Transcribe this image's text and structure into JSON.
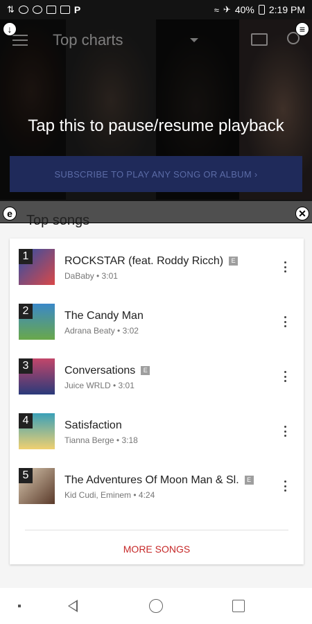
{
  "status_bar": {
    "icons_left": [
      "arrows-icon",
      "bluetooth-icon",
      "data-saver-icon",
      "messages-icon",
      "download-icon"
    ],
    "left_glyph": "P",
    "battery": "40%",
    "time": "2:19 PM"
  },
  "appbar": {
    "title": "Top charts"
  },
  "overlay": {
    "hint": "Tap this to pause/resume playback",
    "bubble_top_left": "↓",
    "bubble_top_right": "≡",
    "bubble_mid_left": "e",
    "bubble_mid_right": "✕"
  },
  "subscribe_label": "SUBSCRIBE TO PLAY ANY SONG OR ALBUM ›",
  "section_title": "Top songs",
  "songs": [
    {
      "rank": "1",
      "title": "ROCKSTAR (feat. Roddy Ricch)",
      "meta": "DaBaby • 3:01",
      "explicit": "E",
      "colors": [
        "#2b4fa8",
        "#d94848"
      ]
    },
    {
      "rank": "2",
      "title": "The Candy Man",
      "meta": "Adrana Beaty • 3:02",
      "explicit": "",
      "colors": [
        "#3a88c8",
        "#6aa84a"
      ]
    },
    {
      "rank": "3",
      "title": "Conversations",
      "meta": "Juice WRLD • 3:01",
      "explicit": "E",
      "colors": [
        "#c2466a",
        "#2a3a7a"
      ]
    },
    {
      "rank": "4",
      "title": "Satisfaction",
      "meta": "Tianna Berge • 3:18",
      "explicit": "",
      "colors": [
        "#3aa0b8",
        "#f0d070"
      ]
    },
    {
      "rank": "5",
      "title": "The Adventures Of Moon Man & Sl.",
      "meta": "Kid Cudi, Eminem • 4:24",
      "explicit": "E",
      "colors": [
        "#d8c8b0",
        "#5a3a2a"
      ]
    }
  ],
  "more_songs_label": "MORE SONGS"
}
